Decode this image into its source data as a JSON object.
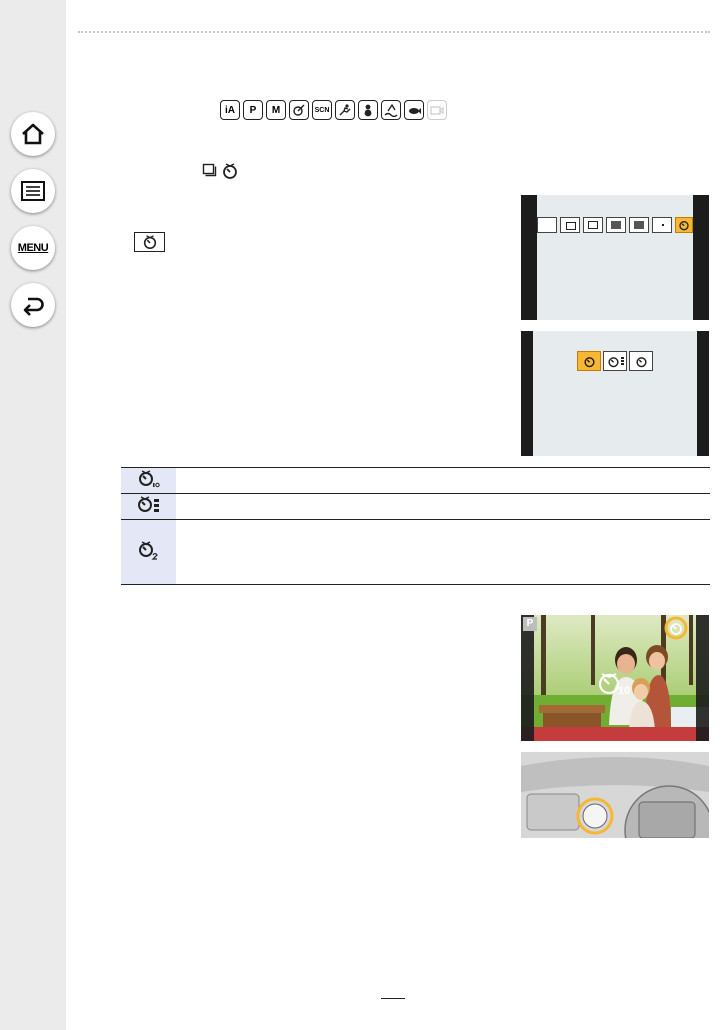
{
  "sidebar": {
    "items": [
      {
        "icon": "home-icon"
      },
      {
        "icon": "list-icon"
      },
      {
        "label": "MENU"
      },
      {
        "icon": "back-icon"
      }
    ]
  },
  "mode_icons": [
    "iA",
    "P",
    "M",
    "",
    "SCN",
    "",
    "",
    "",
    "",
    ""
  ],
  "photo_screen": {
    "mode": "P",
    "timer": "10"
  },
  "colors": {
    "highlight": "#f7b733",
    "sidebar": "#ebebeb",
    "table_icon_cell": "#e4e8f6"
  }
}
